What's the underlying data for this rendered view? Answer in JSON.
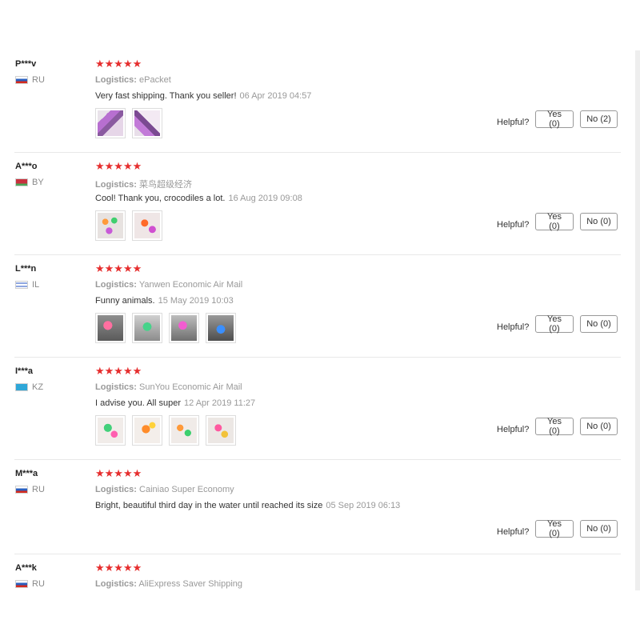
{
  "reviews": [
    {
      "user": "P***v",
      "country": "RU",
      "flag": "ru",
      "rating": 5,
      "stars": "★★★★★",
      "logistics_label": "Logistics:",
      "logistics": "ePacket",
      "comment": "Very fast shipping. Thank you seller!",
      "date": "06 Apr 2019 04:57",
      "photos": 2,
      "helpful_label": "Helpful?",
      "yes": "Yes (0)",
      "no": "No (2)"
    },
    {
      "user": "A***o",
      "country": "BY",
      "flag": "by",
      "rating": 5,
      "stars": "★★★★★",
      "logistics_label": "Logistics:",
      "logistics": "菜鸟超级经济",
      "comment": "Cool! Thank you, crocodiles a lot.",
      "date": "16 Aug 2019 09:08",
      "photos": 2,
      "helpful_label": "Helpful?",
      "yes": "Yes (0)",
      "no": "No (0)"
    },
    {
      "user": "L***n",
      "country": "IL",
      "flag": "il",
      "rating": 5,
      "stars": "★★★★★",
      "logistics_label": "Logistics:",
      "logistics": "Yanwen Economic Air Mail",
      "comment": "Funny animals.",
      "date": "15 May 2019 10:03",
      "photos": 4,
      "helpful_label": "Helpful?",
      "yes": "Yes (0)",
      "no": "No (0)"
    },
    {
      "user": "I***a",
      "country": "KZ",
      "flag": "kz",
      "rating": 5,
      "stars": "★★★★★",
      "logistics_label": "Logistics:",
      "logistics": "SunYou Economic Air Mail",
      "comment": "I advise you. All super",
      "date": "12 Apr 2019 11:27",
      "photos": 4,
      "helpful_label": "Helpful?",
      "yes": "Yes (0)",
      "no": "No (0)"
    },
    {
      "user": "M***a",
      "country": "RU",
      "flag": "ru",
      "rating": 5,
      "stars": "★★★★★",
      "logistics_label": "Logistics:",
      "logistics": "Cainiao Super Economy",
      "comment": "Bright, beautiful third day in the water until reached its size",
      "date": "05 Sep 2019 06:13",
      "photos": 0,
      "helpful_label": "Helpful?",
      "yes": "Yes (0)",
      "no": "No (0)"
    },
    {
      "user": "A***k",
      "country": "RU",
      "flag": "ru",
      "rating": 5,
      "stars": "★★★★★",
      "logistics_label": "Logistics:",
      "logistics": "AliExpress Saver Shipping",
      "comment": "",
      "date": "",
      "photos": 0,
      "helpful_label": "",
      "yes": "",
      "no": ""
    }
  ],
  "colors": {
    "star": "#e62e2e",
    "photo_palette": [
      "#c77dd6",
      "#ff8c3a",
      "#36c26b",
      "#ffd23a",
      "#3a8fff",
      "#ff4f8b"
    ]
  }
}
